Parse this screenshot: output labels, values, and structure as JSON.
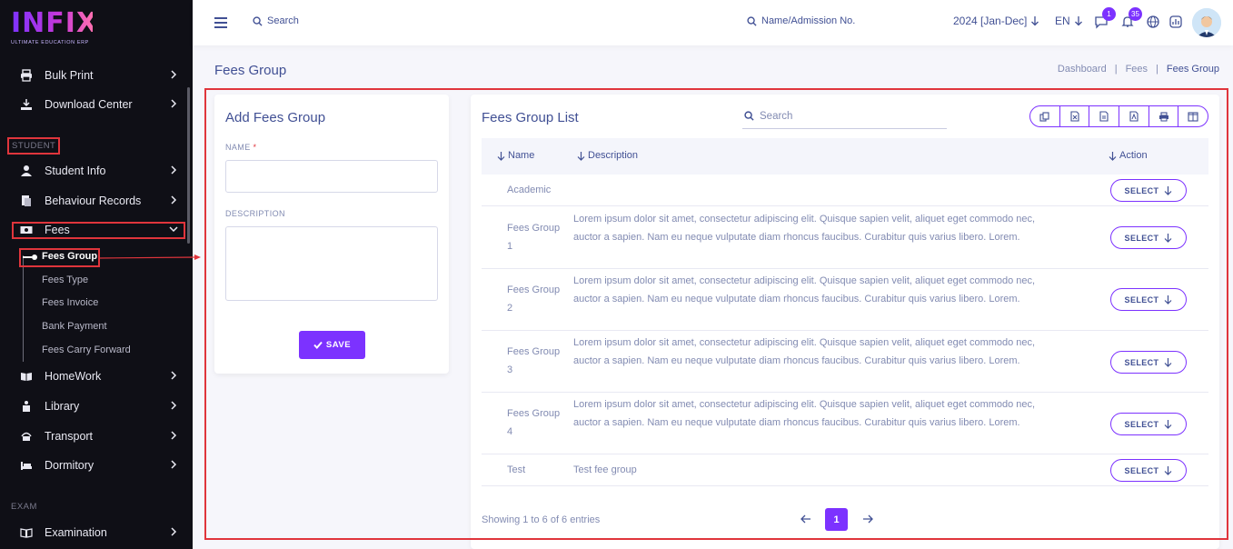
{
  "brand": {
    "logo_text": "INFIX",
    "tagline": "ULTIMATE EDUCATION ERP"
  },
  "sidebar": {
    "items_top": [
      {
        "label": "Bulk Print",
        "icon": "printer-icon"
      },
      {
        "label": "Download Center",
        "icon": "download-icon"
      }
    ],
    "section_student": "STUDENT",
    "items_student": [
      {
        "label": "Student Info",
        "icon": "student-icon"
      },
      {
        "label": "Behaviour Records",
        "icon": "records-icon"
      },
      {
        "label": "Fees",
        "icon": "money-icon"
      }
    ],
    "fees_sub": [
      {
        "label": "Fees Group",
        "active": true
      },
      {
        "label": "Fees Type"
      },
      {
        "label": "Fees Invoice"
      },
      {
        "label": "Bank Payment"
      },
      {
        "label": "Fees Carry Forward"
      }
    ],
    "items_after": [
      {
        "label": "HomeWork",
        "icon": "book-icon"
      },
      {
        "label": "Library",
        "icon": "library-icon"
      },
      {
        "label": "Transport",
        "icon": "bus-icon"
      },
      {
        "label": "Dormitory",
        "icon": "bed-icon"
      }
    ],
    "section_exam": "EXAM",
    "items_exam": [
      {
        "label": "Examination",
        "icon": "exam-icon"
      }
    ]
  },
  "header": {
    "search_label": "Search",
    "admission_search_label": "Name/Admission No.",
    "academic_year": "2024 [Jan-Dec]",
    "language": "EN",
    "messages_count": "1",
    "notifications_count": "35"
  },
  "page": {
    "title": "Fees Group",
    "breadcrumb": [
      "Dashboard",
      "|",
      "Fees",
      "|",
      "Fees Group"
    ]
  },
  "add_form": {
    "title": "Add Fees Group",
    "name_label": "NAME",
    "required_mark": "*",
    "name_value": "",
    "description_label": "DESCRIPTION",
    "description_value": "",
    "save_label": "SAVE"
  },
  "list": {
    "title": "Fees Group List",
    "search_placeholder": "Search",
    "toolbar_icons": [
      "copy-icon",
      "excel-icon",
      "csv-icon",
      "pdf-icon",
      "print-icon",
      "columns-icon"
    ],
    "columns": {
      "name": "Name",
      "description": "Description",
      "action": "Action"
    },
    "select_label": "SELECT",
    "rows": [
      {
        "name": "Academic",
        "description": ""
      },
      {
        "name": "Fees Group 1",
        "description": "Lorem ipsum dolor sit amet, consectetur adipiscing elit. Quisque sapien velit, aliquet eget commodo nec, auctor a sapien. Nam eu neque vulputate diam rhoncus faucibus. Curabitur quis varius libero. Lorem."
      },
      {
        "name": "Fees Group 2",
        "description": "Lorem ipsum dolor sit amet, consectetur adipiscing elit. Quisque sapien velit, aliquet eget commodo nec, auctor a sapien. Nam eu neque vulputate diam rhoncus faucibus. Curabitur quis varius libero. Lorem."
      },
      {
        "name": "Fees Group 3",
        "description": "Lorem ipsum dolor sit amet, consectetur adipiscing elit. Quisque sapien velit, aliquet eget commodo nec, auctor a sapien. Nam eu neque vulputate diam rhoncus faucibus. Curabitur quis varius libero. Lorem."
      },
      {
        "name": "Fees Group 4",
        "description": "Lorem ipsum dolor sit amet, consectetur adipiscing elit. Quisque sapien velit, aliquet eget commodo nec, auctor a sapien. Nam eu neque vulputate diam rhoncus faucibus. Curabitur quis varius libero. Lorem."
      },
      {
        "name": "Test",
        "description": "Test fee group"
      }
    ],
    "showing_text": "Showing 1 to 6 of 6 entries",
    "current_page": "1"
  },
  "colors": {
    "accent": "#7c32ff",
    "primary_text": "#415094",
    "muted_text": "#828bb2",
    "sidebar_bg": "#0f0f16",
    "highlight": "#e0353c"
  }
}
